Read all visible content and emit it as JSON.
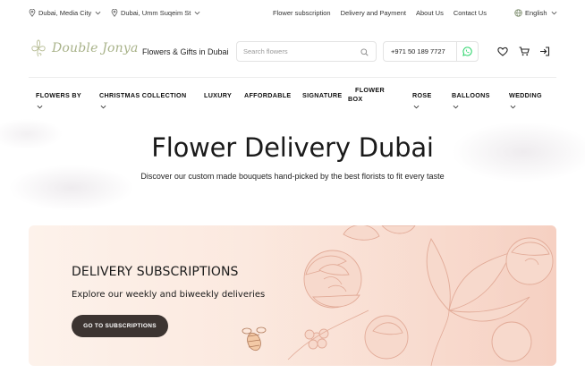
{
  "topbar": {
    "location_city": "Dubai, Media City",
    "location_area": "Dubai, Umm Suqeim St",
    "links": [
      "Flower subscription",
      "Delivery and Payment",
      "About Us",
      "Contact Us"
    ],
    "language": "English"
  },
  "header": {
    "logo_text": "Double Jonya",
    "tagline": "Flowers & Gifts in Dubai",
    "search_placeholder": "Search flowers",
    "phone": "+971 50 189 7727",
    "icons": [
      "whatsapp-icon",
      "heart-icon",
      "cart-icon",
      "login-icon"
    ]
  },
  "nav": {
    "items": [
      {
        "label": "FLOWERS BY",
        "dropdown": true
      },
      {
        "label": "CHRISTMAS COLLECTION",
        "dropdown": true
      },
      {
        "label": "LUXURY",
        "dropdown": false
      },
      {
        "label": "AFFORDABLE",
        "dropdown": false
      },
      {
        "label": "SIGNATURE",
        "dropdown": false
      },
      {
        "label": "FLOWER BOX",
        "line1": "FLOWER",
        "line2": "BOX",
        "dropdown": false
      },
      {
        "label": "ROSE",
        "dropdown": true
      },
      {
        "label": "BALLOONS",
        "dropdown": true
      },
      {
        "label": "WEDDING",
        "dropdown": true
      }
    ]
  },
  "hero": {
    "title": "Flower Delivery Dubai",
    "subtitle": "Discover our custom made bouquets hand-picked by the best florists to fit every taste"
  },
  "banner": {
    "title": "DELIVERY SUBSCRIPTIONS",
    "subtitle": "Explore our weekly and biweekly deliveries",
    "button_label": "GO TO SUBSCRIPTIONS"
  },
  "colors": {
    "logo": "#a9b38a",
    "button_bg": "#3c3431",
    "banner_bg": "#fbe8de",
    "flower_line": "#e7b6a6",
    "whatsapp": "#25d366"
  }
}
